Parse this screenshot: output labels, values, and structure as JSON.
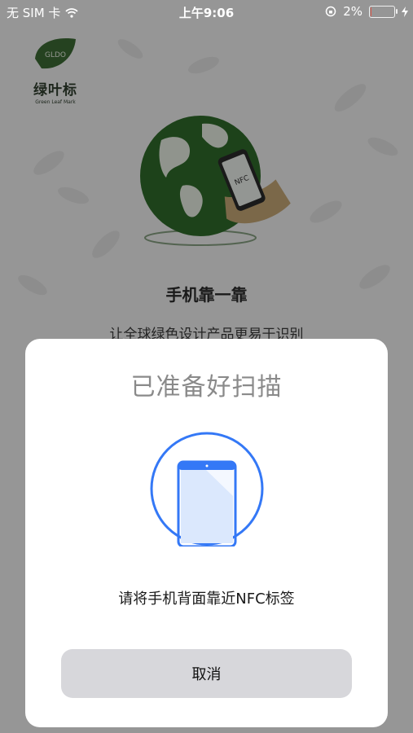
{
  "status_bar": {
    "carrier": "无 SIM 卡",
    "time": "上午9:06",
    "battery_percent_label": "2%",
    "battery_level": 0.02,
    "icons": [
      "wifi-icon",
      "orientation-lock-icon",
      "battery-icon",
      "charging-bolt-icon"
    ]
  },
  "logo": {
    "badge_text": "GLDO",
    "name": "绿叶标",
    "subtitle": "Green Leaf Mark"
  },
  "background": {
    "illustration_phone_label": "NFC",
    "title": "手机靠一靠",
    "subtitle": "让全球绿色设计产品更易于识别"
  },
  "dialog": {
    "title": "已准备好扫描",
    "message": "请将手机背面靠近NFC标签",
    "cancel_label": "取消"
  },
  "colors": {
    "accent_blue": "#3478f6",
    "earth_green": "#2f6b2a",
    "dialog_bg": "#ffffff",
    "button_bg": "#d7d7db"
  }
}
